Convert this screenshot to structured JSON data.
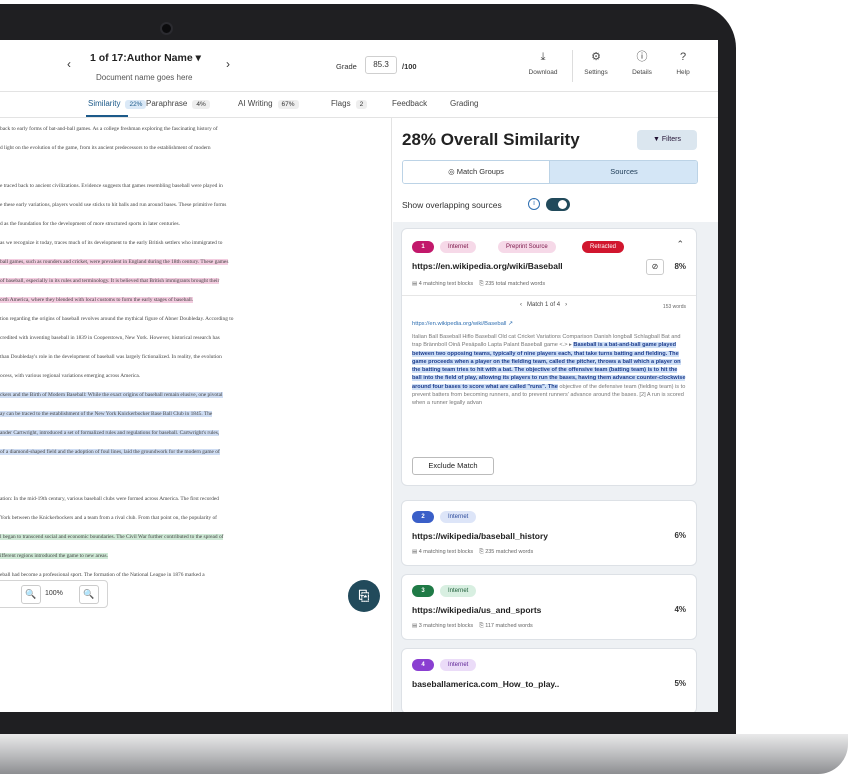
{
  "header": {
    "prev_icon": "‹",
    "next_icon": "›",
    "author": "1 of 17:Author Name  ▾",
    "document_name": "Document name goes here",
    "grade_label": "Grade",
    "grade_value": "85.3",
    "grade_max": "/100"
  },
  "toolbar": [
    {
      "icon": "⤓",
      "label": "Download"
    },
    {
      "icon": "⚙",
      "label": "Settings"
    },
    {
      "icon": "ⓘ",
      "label": "Details"
    },
    {
      "icon": "?",
      "label": "Help"
    }
  ],
  "tabs": [
    {
      "label": "Similarity",
      "badge": "22%"
    },
    {
      "label": "Paraphrase",
      "badge": "4%"
    },
    {
      "label": "AI Writing",
      "badge": "67%"
    },
    {
      "label": "Flags",
      "badge": "2"
    },
    {
      "label": "Feedback"
    },
    {
      "label": "Grading"
    }
  ],
  "colors": {
    "accent": "#1c5a8a",
    "highlight_pink": "#f3cde0",
    "highlight_blue": "#cfddf3",
    "highlight_green": "#cfe9d6",
    "fab": "#214a5b"
  },
  "document": {
    "lines": [
      {
        "t": "back to early forms of bat-and-ball games. As a college freshman exploring the fascinating history of",
        "h": ""
      },
      {
        "t": "d light on the evolution of the game, from its ancient predecessors to the establishment of modern",
        "h": ""
      },
      {
        "t": "",
        "h": ""
      },
      {
        "t": "e traced back to ancient civilizations. Evidence suggests that games resembling baseball were played in",
        "h": ""
      },
      {
        "t": "e these early variations, players would use sticks to hit balls and run around bases. These primitive forms",
        "h": ""
      },
      {
        "t": "d as the foundation for the development of more structured sports in later centuries.",
        "h": ""
      },
      {
        "t": "as we recognize it today, traces much of its development to the early British settlers who immigrated to",
        "h": ""
      },
      {
        "t": "ball games, such as rounders and cricket, were prevalent in England during the 18th century. These games",
        "h": "pink"
      },
      {
        "t": "of baseball, especially in its rules and terminology. It is believed that British immigrants brought their",
        "h": "pink"
      },
      {
        "t": "orth America, where they blended with local customs to form the early stages of baseball.",
        "h": "pink"
      },
      {
        "t": "tion regarding the origins of baseball revolves around the mythical figure of Abner Doubleday. According to",
        "h": ""
      },
      {
        "t": "credited with inventing baseball in 1839 in Cooperstown, New York. However, historical research has",
        "h": ""
      },
      {
        "t": "than Doubleday's role in the development of baseball was largely fictionalized. In reality, the evolution",
        "h": ""
      },
      {
        "t": "ocess, with various regional variations emerging across America.",
        "h": ""
      },
      {
        "t": "ckers and the Birth of Modern Baseball: While the exact origins of baseball remain elusive, one pivotal",
        "h": "blue"
      },
      {
        "t": "ay can be traced to the establishment of the New York Knickerbocker Base Ball Club in 1845. The",
        "h": "blue"
      },
      {
        "t": "ander Cartwright, introduced a set of formalized rules and regulations for baseball. Cartwright's rules,",
        "h": "blue"
      },
      {
        "t": "of a diamond-shaped field and the adoption of foul lines, laid the groundwork for the modern game of",
        "h": "blue"
      },
      {
        "t": "",
        "h": ""
      },
      {
        "t": "ation: In the mid-19th century, various baseball clubs were formed across America. The first recorded",
        "h": ""
      },
      {
        "t": "York between the Knickerbockers and a team from a rival club. From that point on, the popularity of",
        "h": ""
      },
      {
        "t": "l began to transcend social and economic boundaries. The Civil War further contributed to the spread of",
        "h": "green"
      },
      {
        "t": "ifferent regions introduced the game to new areas.",
        "h": "green"
      },
      {
        "t": "eball had become a professional sport. The formation of the National League in 1876 marked a",
        "h": ""
      }
    ]
  },
  "zoom": {
    "out_icon": "🔍",
    "level": "100%",
    "in_icon": "🔍"
  },
  "fab": {
    "icon": "⎘"
  },
  "panel": {
    "title": "28% Overall Similarity",
    "filter_icon": "▼",
    "filters_label": "Filters",
    "match_groups_icon": "◎",
    "match_groups_label": "Match Groups",
    "sources_label": "Sources",
    "overlap_label": "Show overlapping sources",
    "info_icon": "i"
  },
  "sources": [
    {
      "number": "1",
      "type": "Internet",
      "extra_pill": "Preprint Source",
      "status_pill": "Retracted",
      "collapse_icon": "⌃",
      "url": "https://en.wikipedia.org/wiki/Baseball",
      "hide_icon": "⊘",
      "percent": "8%",
      "blocks": "▤ 4 matching text blocks",
      "words": "⎘ 235 total matched words",
      "prev_icon": "‹",
      "match_pager": "Match 1 of 4",
      "next_icon": "›",
      "word_count": "153 words",
      "link": "https://en.wikipedia.org/wiki/Baseball",
      "link_icon": "↗",
      "snippet_before": "Italian Ball Baseball Hiflo Baseball Old cat Cricket Variations Comparison Danish longball Schlagball Bat and trap Brännboll Oină Pesäpallo Lapta Palant Baseball game <.> ▸",
      "snippet_match": "Baseball is a bat-and-ball game played between two opposing teams, typically of nine players each, that take turns batting and fielding. The game proceeds when a player on the fielding team, called the pitcher, throws a ball which a player on the batting team tries to hit with a bat. The objective of the offensive team (batting team) is to hit the ball into the field of play, allowing its players to run the bases, having them advance counter-clockwise around four bases to score what are called \"runs\". The",
      "snippet_after": "objective of the defensive team (fielding team) is to prevent batters from becoming runners, and to prevent runners' advance around the bases. [2] A run is scored when a runner legally advan",
      "exclude_label": "Exclude Match"
    },
    {
      "number": "2",
      "type": "Internet",
      "url": "https://wikipedia/baseball_history",
      "percent": "6%",
      "blocks": "▤ 4 matching text blocks",
      "words": "⎘ 235 matched words"
    },
    {
      "number": "3",
      "type": "Internet",
      "url": "https://wikipedia/us_and_sports",
      "percent": "4%",
      "blocks": "▤ 3 matching text blocks",
      "words": "⎘ 117 matched words"
    },
    {
      "number": "4",
      "type": "Internet",
      "url": "baseballamerica.com_How_to_play..",
      "percent": "5%"
    }
  ]
}
